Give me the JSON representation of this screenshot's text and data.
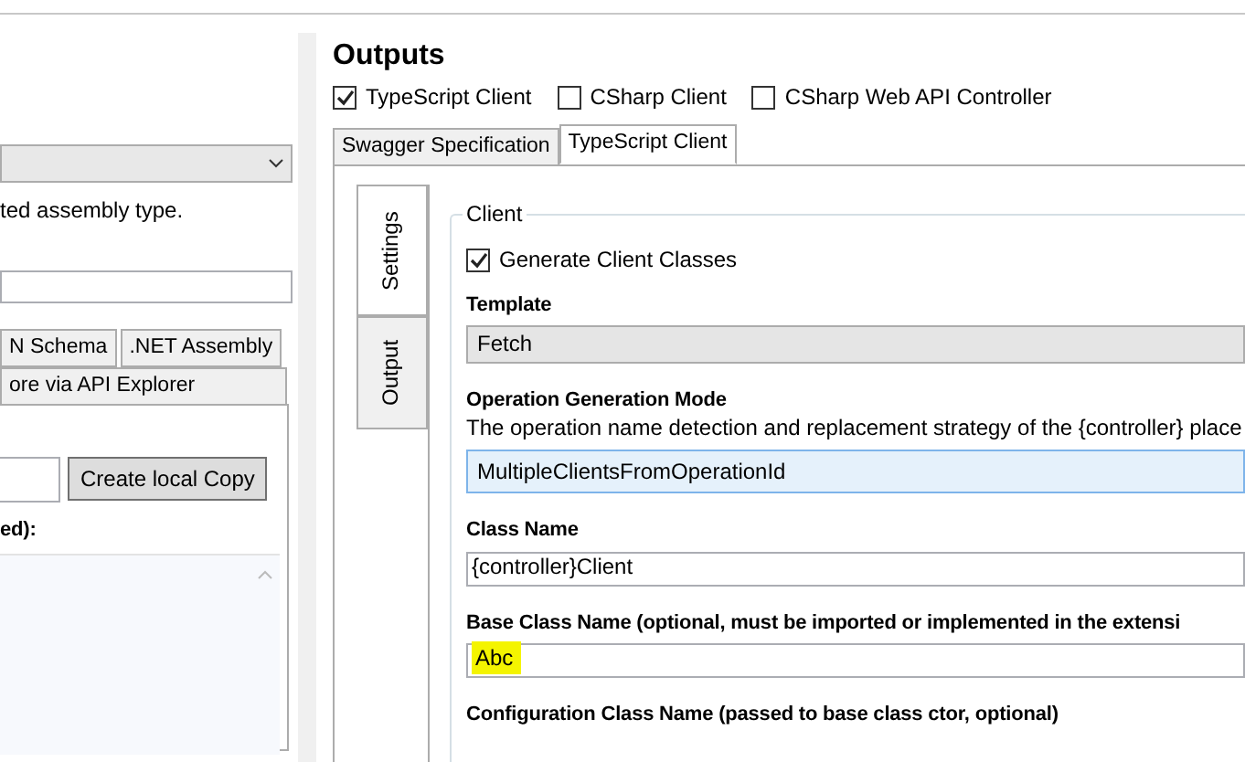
{
  "left_panel": {
    "description": "ted assembly type.",
    "tab_rows": [
      [
        {
          "label": "N Schema",
          "selected": false
        },
        {
          "label": ".NET Assembly",
          "selected": false
        }
      ],
      [
        {
          "label": "ore via API Explorer",
          "selected": false
        }
      ]
    ],
    "copy_button": "Create local Copy",
    "list_label": "ed):"
  },
  "outputs": {
    "title": "Outputs",
    "options": [
      {
        "label": "TypeScript Client",
        "checked": true
      },
      {
        "label": "CSharp Client",
        "checked": false
      },
      {
        "label": "CSharp Web API Controller",
        "checked": false
      }
    ],
    "tabs": [
      {
        "label": "Swagger Specification",
        "selected": false
      },
      {
        "label": "TypeScript Client",
        "selected": true
      }
    ],
    "side_tabs": [
      {
        "label": "Settings",
        "selected": true
      },
      {
        "label": "Output",
        "selected": false
      }
    ],
    "group": {
      "legend": "Client",
      "checkbox": {
        "label": "Generate Client Classes",
        "checked": true
      }
    },
    "fields": [
      {
        "kind": "select",
        "label": "Template",
        "value": "Fetch",
        "focused": false
      },
      {
        "kind": "select",
        "label": "Operation Generation Mode",
        "description": "The operation name detection and replacement strategy of the {controller} place",
        "value": "MultipleClientsFromOperationId",
        "focused": true
      },
      {
        "kind": "text",
        "label": "Class Name",
        "value": "{controller}Client",
        "highlighted": false
      },
      {
        "kind": "text",
        "label": "Base Class Name (optional, must be imported or implemented in the extensi",
        "value": "Abc",
        "highlighted": true
      },
      {
        "kind": "label",
        "label": "Configuration Class Name (passed to base class ctor, optional)"
      }
    ]
  }
}
